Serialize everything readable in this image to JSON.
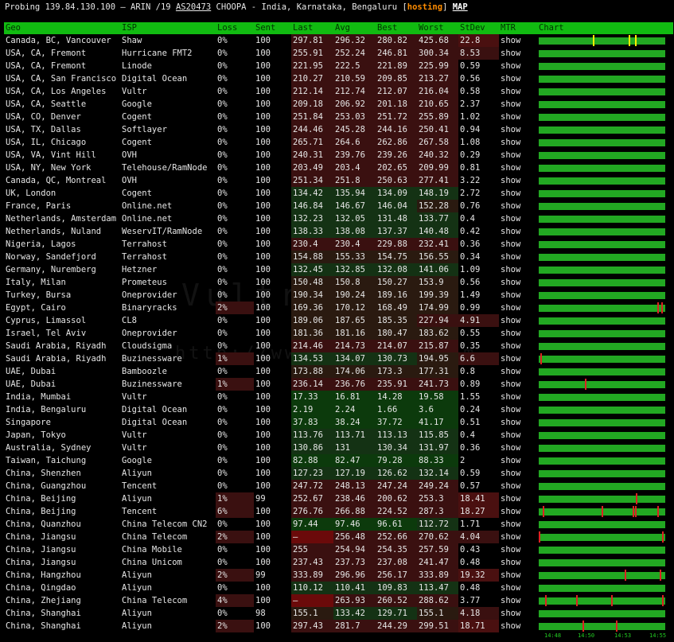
{
  "header": {
    "prefix": "Probing 139.84.130.100 – ARIN /19",
    "asn": "AS20473",
    "location": "CHOOPA - India, Karnataka, Bengaluru",
    "tag": "hosting",
    "map_link": "MAP"
  },
  "watermark": {
    "text": "Vultr中文网",
    "url": "http://www.vultrcn.com"
  },
  "columns": [
    "Geo",
    "ISP",
    "Loss",
    "Sent",
    "Last",
    "Avg",
    "Best",
    "Worst",
    "StDev",
    "MTR",
    "Chart"
  ],
  "rows": [
    {
      "geo": "Canada, BC, Vancouver",
      "isp": "Shaw",
      "loss": "0%",
      "sent": "100",
      "last": "297.81",
      "avg": "296.32",
      "best": "280.82",
      "worst": "425.68",
      "stdev": "22.8",
      "mtr": "show",
      "spikes": [
        {
          "pos": 0.43,
          "color": "#ffee00"
        },
        {
          "pos": 0.72,
          "color": "#ffee00"
        },
        {
          "pos": 0.77,
          "color": "#ffee00"
        }
      ]
    },
    {
      "geo": "USA, CA, Fremont",
      "isp": "Hurricane FMT2",
      "loss": "0%",
      "sent": "100",
      "last": "255.91",
      "avg": "252.24",
      "best": "246.81",
      "worst": "300.34",
      "stdev": "8.53",
      "mtr": "show",
      "spikes": []
    },
    {
      "geo": "USA, CA, Fremont",
      "isp": "Linode",
      "loss": "0%",
      "sent": "100",
      "last": "221.95",
      "avg": "222.5",
      "best": "221.89",
      "worst": "225.99",
      "stdev": "0.59",
      "mtr": "show",
      "spikes": []
    },
    {
      "geo": "USA, CA, San Francisco",
      "isp": "Digital Ocean",
      "loss": "0%",
      "sent": "100",
      "last": "210.27",
      "avg": "210.59",
      "best": "209.85",
      "worst": "213.27",
      "stdev": "0.56",
      "mtr": "show",
      "spikes": []
    },
    {
      "geo": "USA, CA, Los Angeles",
      "isp": "Vultr",
      "loss": "0%",
      "sent": "100",
      "last": "212.14",
      "avg": "212.74",
      "best": "212.07",
      "worst": "216.04",
      "stdev": "0.58",
      "mtr": "show",
      "spikes": []
    },
    {
      "geo": "USA, CA, Seattle",
      "isp": "Google",
      "loss": "0%",
      "sent": "100",
      "last": "209.18",
      "avg": "206.92",
      "best": "201.18",
      "worst": "210.65",
      "stdev": "2.37",
      "mtr": "show",
      "spikes": []
    },
    {
      "geo": "USA, CO, Denver",
      "isp": "Cogent",
      "loss": "0%",
      "sent": "100",
      "last": "251.84",
      "avg": "253.03",
      "best": "251.72",
      "worst": "255.89",
      "stdev": "1.02",
      "mtr": "show",
      "spikes": []
    },
    {
      "geo": "USA, TX, Dallas",
      "isp": "Softlayer",
      "loss": "0%",
      "sent": "100",
      "last": "244.46",
      "avg": "245.28",
      "best": "244.16",
      "worst": "250.41",
      "stdev": "0.94",
      "mtr": "show",
      "spikes": []
    },
    {
      "geo": "USA, IL, Chicago",
      "isp": "Cogent",
      "loss": "0%",
      "sent": "100",
      "last": "265.71",
      "avg": "264.6",
      "best": "262.86",
      "worst": "267.58",
      "stdev": "1.08",
      "mtr": "show",
      "spikes": []
    },
    {
      "geo": "USA, VA, Vint Hill",
      "isp": "OVH",
      "loss": "0%",
      "sent": "100",
      "last": "240.31",
      "avg": "239.76",
      "best": "239.26",
      "worst": "240.32",
      "stdev": "0.29",
      "mtr": "show",
      "spikes": []
    },
    {
      "geo": "USA, NY, New York",
      "isp": "Telehouse/RamNode",
      "loss": "0%",
      "sent": "100",
      "last": "203.49",
      "avg": "203.4",
      "best": "202.65",
      "worst": "209.99",
      "stdev": "0.81",
      "mtr": "show",
      "spikes": []
    },
    {
      "geo": "Canada, QC, Montreal",
      "isp": "OVH",
      "loss": "0%",
      "sent": "100",
      "last": "251.34",
      "avg": "251.8",
      "best": "250.63",
      "worst": "277.41",
      "stdev": "3.22",
      "mtr": "show",
      "spikes": []
    },
    {
      "geo": "UK, London",
      "isp": "Cogent",
      "loss": "0%",
      "sent": "100",
      "last": "134.42",
      "avg": "135.94",
      "best": "134.09",
      "worst": "148.19",
      "stdev": "2.72",
      "mtr": "show",
      "spikes": []
    },
    {
      "geo": "France, Paris",
      "isp": "Online.net",
      "loss": "0%",
      "sent": "100",
      "last": "146.84",
      "avg": "146.67",
      "best": "146.04",
      "worst": "152.28",
      "stdev": "0.76",
      "mtr": "show",
      "spikes": []
    },
    {
      "geo": "Netherlands, Amsterdam",
      "isp": "Online.net",
      "loss": "0%",
      "sent": "100",
      "last": "132.23",
      "avg": "132.05",
      "best": "131.48",
      "worst": "133.77",
      "stdev": "0.4",
      "mtr": "show",
      "spikes": []
    },
    {
      "geo": "Netherlands, Nuland",
      "isp": "WeservIT/RamNode",
      "loss": "0%",
      "sent": "100",
      "last": "138.33",
      "avg": "138.08",
      "best": "137.37",
      "worst": "140.48",
      "stdev": "0.42",
      "mtr": "show",
      "spikes": []
    },
    {
      "geo": "Nigeria, Lagos",
      "isp": "Terrahost",
      "loss": "0%",
      "sent": "100",
      "last": "230.4",
      "avg": "230.4",
      "best": "229.88",
      "worst": "232.41",
      "stdev": "0.36",
      "mtr": "show",
      "spikes": []
    },
    {
      "geo": "Norway, Sandefjord",
      "isp": "Terrahost",
      "loss": "0%",
      "sent": "100",
      "last": "154.88",
      "avg": "155.33",
      "best": "154.75",
      "worst": "156.55",
      "stdev": "0.34",
      "mtr": "show",
      "spikes": []
    },
    {
      "geo": "Germany, Nuremberg",
      "isp": "Hetzner",
      "loss": "0%",
      "sent": "100",
      "last": "132.45",
      "avg": "132.85",
      "best": "132.08",
      "worst": "141.06",
      "stdev": "1.09",
      "mtr": "show",
      "spikes": []
    },
    {
      "geo": "Italy, Milan",
      "isp": "Prometeus",
      "loss": "0%",
      "sent": "100",
      "last": "150.48",
      "avg": "150.8",
      "best": "150.27",
      "worst": "153.9",
      "stdev": "0.56",
      "mtr": "show",
      "spikes": []
    },
    {
      "geo": "Turkey, Bursa",
      "isp": "Oneprovider",
      "loss": "0%",
      "sent": "100",
      "last": "190.34",
      "avg": "190.24",
      "best": "189.16",
      "worst": "199.39",
      "stdev": "1.49",
      "mtr": "show",
      "spikes": []
    },
    {
      "geo": "Egypt, Cairo",
      "isp": "Binaryracks",
      "loss": "2%",
      "sent": "100",
      "last": "169.36",
      "avg": "170.12",
      "best": "168.49",
      "worst": "174.99",
      "stdev": "0.99",
      "mtr": "show",
      "spikes": [
        {
          "pos": 0.95,
          "color": "#dd2222"
        },
        {
          "pos": 0.98,
          "color": "#dd2222"
        }
      ]
    },
    {
      "geo": "Cyprus, Limassol",
      "isp": "CL8",
      "loss": "0%",
      "sent": "100",
      "last": "189.06",
      "avg": "187.65",
      "best": "185.35",
      "worst": "227.94",
      "stdev": "4.91",
      "mtr": "show",
      "spikes": []
    },
    {
      "geo": "Israel, Tel Aviv",
      "isp": "Oneprovider",
      "loss": "0%",
      "sent": "100",
      "last": "181.36",
      "avg": "181.16",
      "best": "180.47",
      "worst": "183.62",
      "stdev": "0.55",
      "mtr": "show",
      "spikes": []
    },
    {
      "geo": "Saudi Arabia, Riyadh",
      "isp": "Cloudsigma",
      "loss": "0%",
      "sent": "100",
      "last": "214.46",
      "avg": "214.73",
      "best": "214.07",
      "worst": "215.87",
      "stdev": "0.35",
      "mtr": "show",
      "spikes": []
    },
    {
      "geo": "Saudi Arabia, Riyadh",
      "isp": "Buzinessware",
      "loss": "1%",
      "sent": "100",
      "last": "134.53",
      "avg": "134.07",
      "best": "130.73",
      "worst": "194.95",
      "stdev": "6.6",
      "mtr": "show",
      "spikes": [
        {
          "pos": 0.01,
          "color": "#dd2222"
        }
      ]
    },
    {
      "geo": "UAE, Dubai",
      "isp": "Bamboozle",
      "loss": "0%",
      "sent": "100",
      "last": "173.88",
      "avg": "174.06",
      "best": "173.3",
      "worst": "177.31",
      "stdev": "0.8",
      "mtr": "show",
      "spikes": []
    },
    {
      "geo": "UAE, Dubai",
      "isp": "Buzinessware",
      "loss": "1%",
      "sent": "100",
      "last": "236.14",
      "avg": "236.76",
      "best": "235.91",
      "worst": "241.73",
      "stdev": "0.89",
      "mtr": "show",
      "spikes": [
        {
          "pos": 0.37,
          "color": "#dd2222"
        }
      ]
    },
    {
      "geo": "India, Mumbai",
      "isp": "Vultr",
      "loss": "0%",
      "sent": "100",
      "last": "17.33",
      "avg": "16.81",
      "best": "14.28",
      "worst": "19.58",
      "stdev": "1.55",
      "mtr": "show",
      "spikes": []
    },
    {
      "geo": "India, Bengaluru",
      "isp": "Digital Ocean",
      "loss": "0%",
      "sent": "100",
      "last": "2.19",
      "avg": "2.24",
      "best": "1.66",
      "worst": "3.6",
      "stdev": "0.24",
      "mtr": "show",
      "spikes": []
    },
    {
      "geo": "Singapore",
      "isp": "Digital Ocean",
      "loss": "0%",
      "sent": "100",
      "last": "37.83",
      "avg": "38.24",
      "best": "37.72",
      "worst": "41.17",
      "stdev": "0.51",
      "mtr": "show",
      "spikes": []
    },
    {
      "geo": "Japan, Tokyo",
      "isp": "Vultr",
      "loss": "0%",
      "sent": "100",
      "last": "113.76",
      "avg": "113.71",
      "best": "113.13",
      "worst": "115.85",
      "stdev": "0.4",
      "mtr": "show",
      "spikes": []
    },
    {
      "geo": "Australia, Sydney",
      "isp": "Vultr",
      "loss": "0%",
      "sent": "100",
      "last": "130.86",
      "avg": "131",
      "best": "130.34",
      "worst": "131.97",
      "stdev": "0.36",
      "mtr": "show",
      "spikes": []
    },
    {
      "geo": "Taiwan, Taichung",
      "isp": "Google",
      "loss": "0%",
      "sent": "100",
      "last": "82.88",
      "avg": "82.47",
      "best": "79.28",
      "worst": "88.33",
      "stdev": "2",
      "mtr": "show",
      "spikes": []
    },
    {
      "geo": "China, Shenzhen",
      "isp": "Aliyun",
      "loss": "0%",
      "sent": "100",
      "last": "127.23",
      "avg": "127.19",
      "best": "126.62",
      "worst": "132.14",
      "stdev": "0.59",
      "mtr": "show",
      "spikes": []
    },
    {
      "geo": "China, Guangzhou",
      "isp": "Tencent",
      "loss": "0%",
      "sent": "100",
      "last": "247.72",
      "avg": "248.13",
      "best": "247.24",
      "worst": "249.24",
      "stdev": "0.57",
      "mtr": "show",
      "spikes": []
    },
    {
      "geo": "China, Beijing",
      "isp": "Aliyun",
      "loss": "1%",
      "sent": "99",
      "last": "252.67",
      "avg": "238.46",
      "best": "200.62",
      "worst": "253.3",
      "stdev": "18.41",
      "mtr": "show",
      "spikes": [
        {
          "pos": 0.78,
          "color": "#dd2222"
        }
      ]
    },
    {
      "geo": "China, Beijing",
      "isp": "Tencent",
      "loss": "6%",
      "sent": "100",
      "last": "276.76",
      "avg": "266.88",
      "best": "224.52",
      "worst": "287.3",
      "stdev": "18.27",
      "mtr": "show",
      "spikes": [
        {
          "pos": 0.03,
          "color": "#dd2222"
        },
        {
          "pos": 0.5,
          "color": "#dd2222"
        },
        {
          "pos": 0.75,
          "color": "#dd2222"
        },
        {
          "pos": 0.77,
          "color": "#dd2222"
        },
        {
          "pos": 0.95,
          "color": "#dd2222"
        }
      ]
    },
    {
      "geo": "China, Quanzhou",
      "isp": "China Telecom CN2",
      "loss": "0%",
      "sent": "100",
      "last": "97.44",
      "avg": "97.46",
      "best": "96.61",
      "worst": "112.72",
      "stdev": "1.71",
      "mtr": "show",
      "spikes": []
    },
    {
      "geo": "China, Jiangsu",
      "isp": "China Telecom",
      "loss": "2%",
      "sent": "100",
      "last": "–",
      "avg": "256.48",
      "best": "252.66",
      "worst": "270.62",
      "stdev": "4.04",
      "mtr": "show",
      "spikes": [
        {
          "pos": 0.0,
          "color": "#dd2222"
        },
        {
          "pos": 0.99,
          "color": "#dd2222"
        }
      ]
    },
    {
      "geo": "China, Jiangsu",
      "isp": "China Mobile",
      "loss": "0%",
      "sent": "100",
      "last": "255",
      "avg": "254.94",
      "best": "254.35",
      "worst": "257.59",
      "stdev": "0.43",
      "mtr": "show",
      "spikes": []
    },
    {
      "geo": "China, Jiangsu",
      "isp": "China Unicom",
      "loss": "0%",
      "sent": "100",
      "last": "237.43",
      "avg": "237.73",
      "best": "237.08",
      "worst": "241.47",
      "stdev": "0.48",
      "mtr": "show",
      "spikes": []
    },
    {
      "geo": "China, Hangzhou",
      "isp": "Aliyun",
      "loss": "2%",
      "sent": "99",
      "last": "333.89",
      "avg": "296.96",
      "best": "256.17",
      "worst": "333.89",
      "stdev": "19.32",
      "mtr": "show",
      "spikes": [
        {
          "pos": 0.69,
          "color": "#dd2222"
        },
        {
          "pos": 0.97,
          "color": "#dd2222"
        }
      ]
    },
    {
      "geo": "China, Qingdao",
      "isp": "Aliyun",
      "loss": "0%",
      "sent": "100",
      "last": "110.12",
      "avg": "110.41",
      "best": "109.83",
      "worst": "113.47",
      "stdev": "0.48",
      "mtr": "show",
      "spikes": []
    },
    {
      "geo": "China, Zhejiang",
      "isp": "China Telecom",
      "loss": "4%",
      "sent": "100",
      "last": "–",
      "avg": "263.93",
      "best": "260.52",
      "worst": "288.62",
      "stdev": "3.77",
      "mtr": "show",
      "spikes": [
        {
          "pos": 0.05,
          "color": "#dd2222"
        },
        {
          "pos": 0.3,
          "color": "#dd2222"
        },
        {
          "pos": 0.58,
          "color": "#dd2222"
        },
        {
          "pos": 0.99,
          "color": "#dd2222"
        }
      ]
    },
    {
      "geo": "China, Shanghai",
      "isp": "Aliyun",
      "loss": "0%",
      "sent": "98",
      "last": "155.1",
      "avg": "133.42",
      "best": "129.71",
      "worst": "155.1",
      "stdev": "4.18",
      "mtr": "show",
      "spikes": []
    },
    {
      "geo": "China, Shanghai",
      "isp": "Aliyun",
      "loss": "2%",
      "sent": "100",
      "last": "297.43",
      "avg": "281.7",
      "best": "244.29",
      "worst": "299.51",
      "stdev": "18.71",
      "mtr": "show",
      "spikes": [
        {
          "pos": 0.35,
          "color": "#dd2222"
        },
        {
          "pos": 0.62,
          "color": "#dd2222"
        }
      ]
    }
  ],
  "time_axis": [
    "14:48",
    "14:50",
    "14:53",
    "14:55"
  ],
  "colors": {
    "header_bg": "#11bb11",
    "bar": "#22a822",
    "link": "#22cc22",
    "hosting": "#ff8c00"
  }
}
